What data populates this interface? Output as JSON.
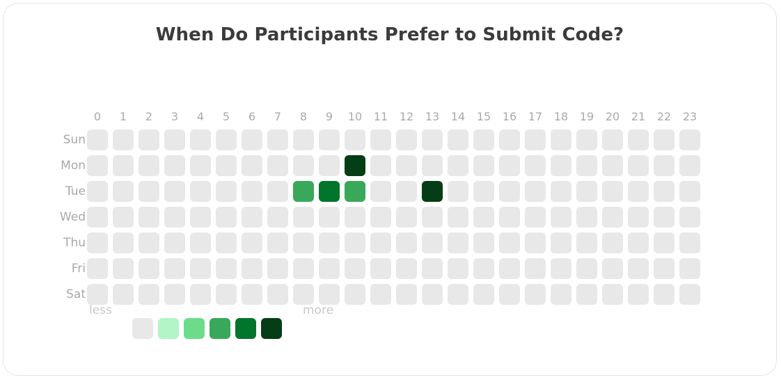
{
  "card": {
    "title": "When Do Participants Prefer to Submit Code?"
  },
  "legend": {
    "less_label": "less",
    "more_label": "more",
    "scale_colors": [
      "#e8e8e8",
      "#b3f5c6",
      "#6cdc8b",
      "#36a css",
      "#00752c",
      "#053d16"
    ]
  },
  "chart_data": {
    "type": "heatmap",
    "title": "When Do Participants Prefer to Submit Code?",
    "xlabel": "",
    "ylabel": "",
    "x": [
      "0",
      "1",
      "2",
      "3",
      "4",
      "5",
      "6",
      "7",
      "8",
      "9",
      "10",
      "11",
      "12",
      "13",
      "14",
      "15",
      "16",
      "17",
      "18",
      "19",
      "20",
      "21",
      "22",
      "23"
    ],
    "y": [
      "Sun",
      "Mon",
      "Tue",
      "Wed",
      "Thu",
      "Fri",
      "Sat"
    ],
    "colorscale": [
      "#e8e8e8",
      "#b3f5c6",
      "#6cdc8b",
      "#39a85a",
      "#00752c",
      "#053d16"
    ],
    "legend": {
      "low": "less",
      "high": "more",
      "position": "bottom-left"
    },
    "zmin": 0,
    "zmax": 5,
    "grid": false,
    "values": [
      [
        0,
        0,
        0,
        0,
        0,
        0,
        0,
        0,
        0,
        0,
        0,
        0,
        0,
        0,
        0,
        0,
        0,
        0,
        0,
        0,
        0,
        0,
        0,
        0
      ],
      [
        0,
        0,
        0,
        0,
        0,
        0,
        0,
        0,
        0,
        0,
        5,
        0,
        0,
        0,
        0,
        0,
        0,
        0,
        0,
        0,
        0,
        0,
        0,
        0
      ],
      [
        0,
        0,
        0,
        0,
        0,
        0,
        0,
        0,
        3,
        4,
        3,
        0,
        0,
        5,
        0,
        0,
        0,
        0,
        0,
        0,
        0,
        0,
        0,
        0
      ],
      [
        0,
        0,
        0,
        0,
        0,
        0,
        0,
        0,
        0,
        0,
        0,
        0,
        0,
        0,
        0,
        0,
        0,
        0,
        0,
        0,
        0,
        0,
        0,
        0
      ],
      [
        0,
        0,
        0,
        0,
        0,
        0,
        0,
        0,
        0,
        0,
        0,
        0,
        0,
        0,
        0,
        0,
        0,
        0,
        0,
        0,
        0,
        0,
        0,
        0
      ],
      [
        0,
        0,
        0,
        0,
        0,
        0,
        0,
        0,
        0,
        0,
        0,
        0,
        0,
        0,
        0,
        0,
        0,
        0,
        0,
        0,
        0,
        0,
        0,
        0
      ],
      [
        0,
        0,
        0,
        0,
        0,
        0,
        0,
        0,
        0,
        0,
        0,
        0,
        0,
        0,
        0,
        0,
        0,
        0,
        0,
        0,
        0,
        0,
        0,
        0
      ]
    ]
  }
}
